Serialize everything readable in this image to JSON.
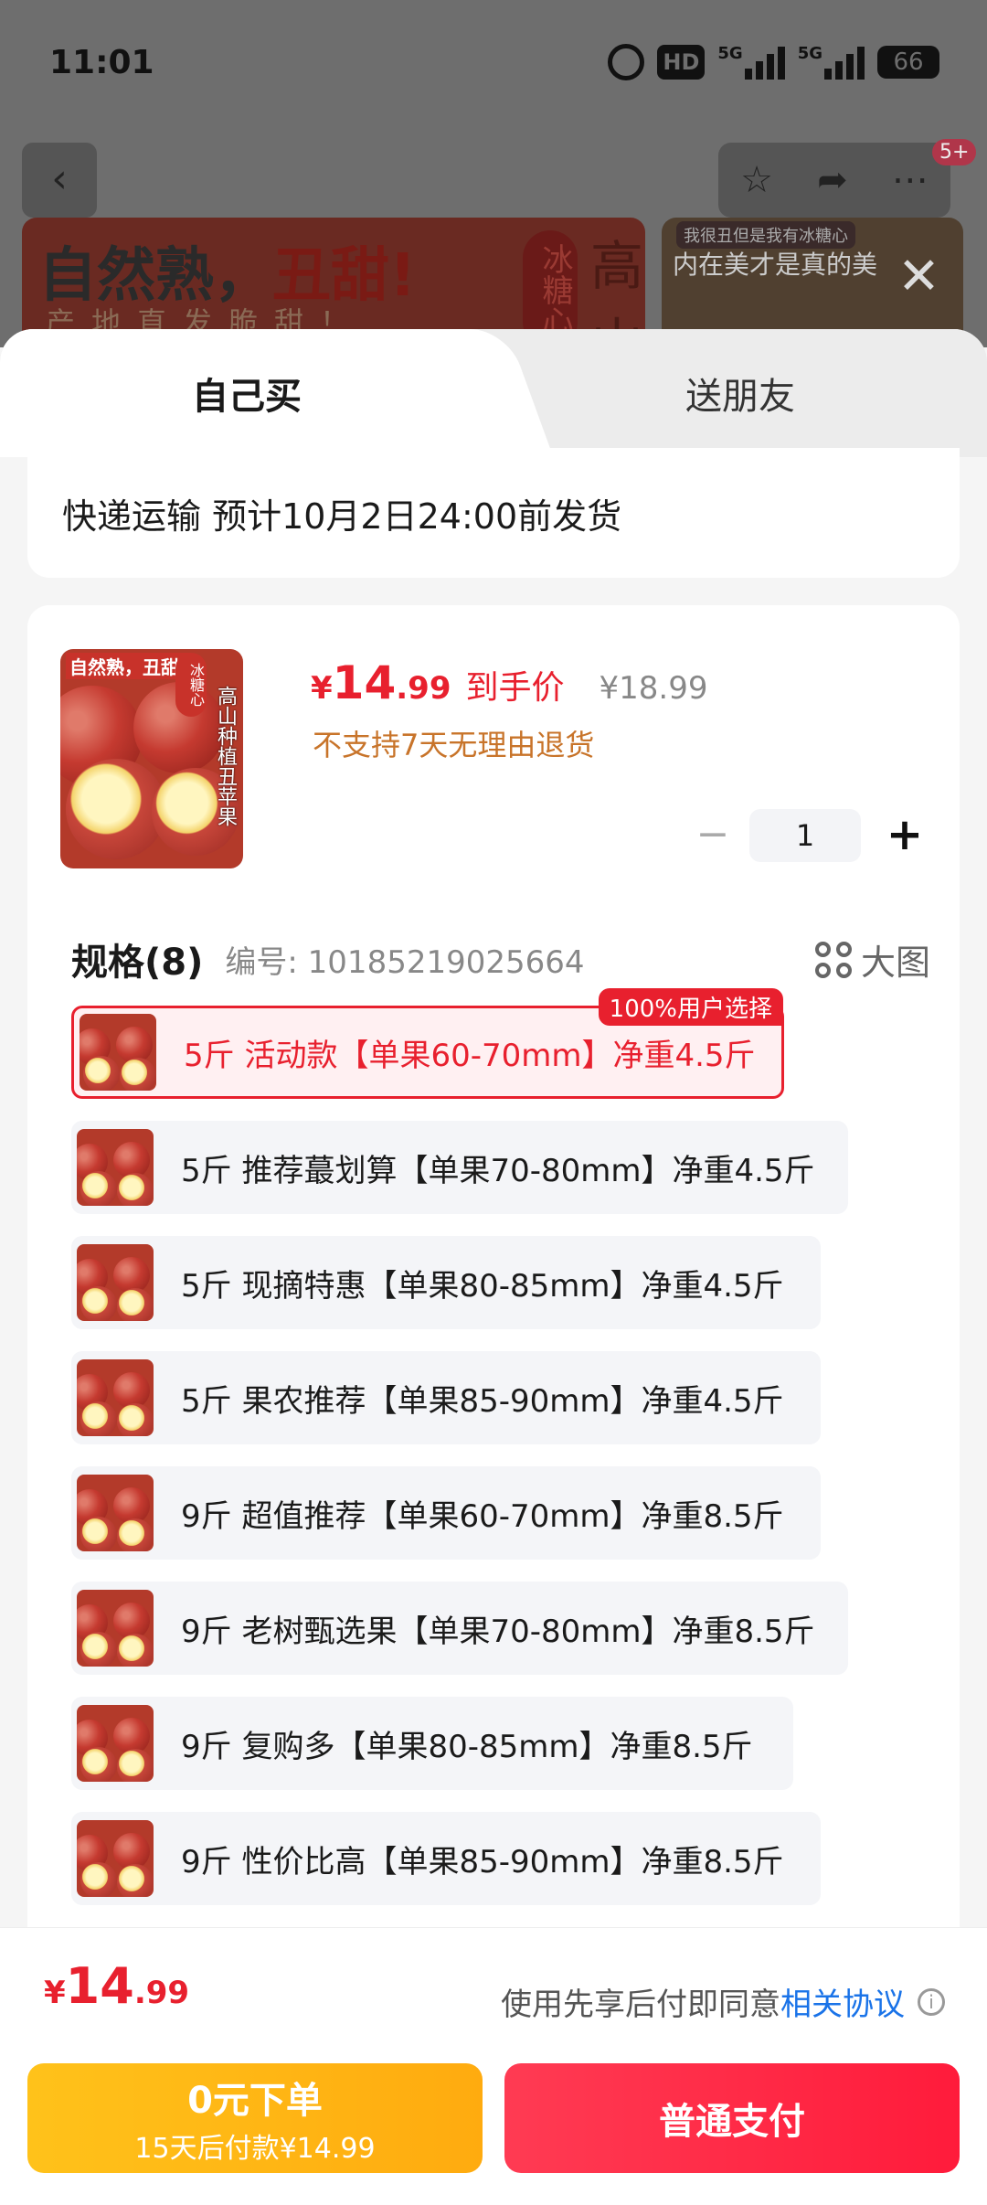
{
  "status_bar": {
    "time": "11:01",
    "hd_label": "HD",
    "net1": "5G",
    "net2": "5G",
    "battery": "66"
  },
  "background": {
    "back_icon": "chevron-left-icon",
    "cart_badge": "5+",
    "banner_left_title_a": "自然熟，",
    "banner_left_title_b": "丑甜!",
    "banner_left_sub": "产地直发脆甜！",
    "banner_left_tag": "冰糖心",
    "banner_left_high": "高山",
    "banner_right_small": "我很丑但是我有冰糖心",
    "banner_right_title": "内在美才是真的美"
  },
  "tabs": [
    {
      "label": "自己买",
      "active": true
    },
    {
      "label": "送朋友",
      "active": false
    }
  ],
  "shipping": "快递运输 预计10月2日24:00前发货",
  "product": {
    "image_label": "自然熟，丑甜!",
    "image_vertical": "高山种植丑苹果",
    "image_tag": "冰糖心",
    "price_symbol": "¥",
    "price_int": "14",
    "price_dec": ".99",
    "price_label": "到手价",
    "price_old": "¥18.99",
    "notice": "不支持7天无理由退货",
    "quantity": "1"
  },
  "spec": {
    "title": "规格(8)",
    "code": "编号: 10185219025664",
    "big_image": "大图",
    "selected_flag": "100%用户选择",
    "items": [
      {
        "label": "5斤 活动款【单果60-70mm】净重4.5斤",
        "selected": true
      },
      {
        "label": "5斤 推荐蕞划算【单果70-80mm】净重4.5斤",
        "selected": false
      },
      {
        "label": "5斤 现摘特惠【单果80-85mm】净重4.5斤",
        "selected": false
      },
      {
        "label": "5斤 果农推荐【单果85-90mm】净重4.5斤",
        "selected": false
      },
      {
        "label": "9斤 超值推荐【单果60-70mm】净重8.5斤",
        "selected": false
      },
      {
        "label": "9斤 老树甄选果【单果70-80mm】净重8.5斤",
        "selected": false
      },
      {
        "label": "9斤 复购多【单果80-85mm】净重8.5斤",
        "selected": false
      },
      {
        "label": "9斤 性价比高【单果85-90mm】净重8.5斤",
        "selected": false
      }
    ]
  },
  "footer": {
    "price_symbol": "¥",
    "price_int": "14",
    "price_dec": ".99",
    "agreement_text": "使用先享后付即同意",
    "agreement_link": "相关协议",
    "bnpl_main": "0元下单",
    "bnpl_sub": "15天后付款¥14.99",
    "pay_label": "普通支付"
  },
  "colors": {
    "accent_red": "#e8202e",
    "bnpl_yellow": "#ffb414",
    "link_blue": "#1a73e8",
    "notice_orange": "#c8742a"
  }
}
